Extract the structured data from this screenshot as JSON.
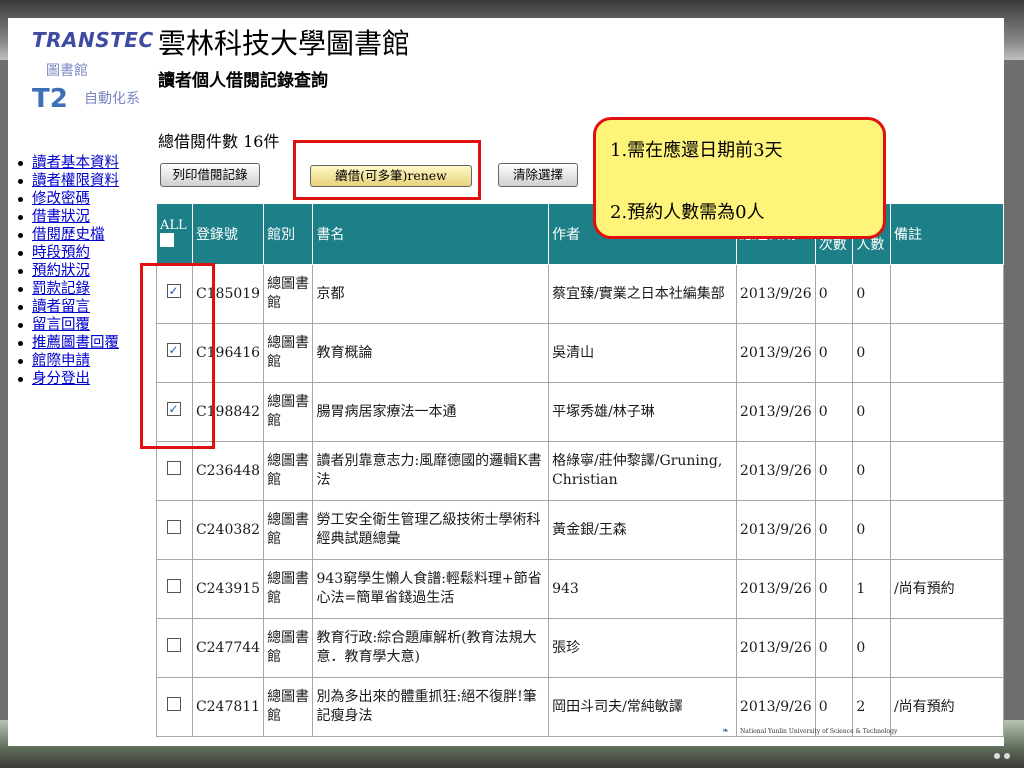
{
  "logo": {
    "brand": "TRANSTEC",
    "brand_sub": "圖書館",
    "t2": "T2",
    "t2_sub": "自動化系"
  },
  "title": "雲林科技大學圖書館",
  "subtitle": "讀者個人借閱記錄查詢",
  "nav": [
    "讀者基本資料",
    "讀者權限資料",
    "修改密碼",
    "借書狀況",
    "借閱歷史檔",
    "時段預約",
    "預約狀況",
    "罰款記錄",
    "讀者留言",
    "留言回覆",
    "推薦圖書回覆",
    "館際申請",
    "身分登出"
  ],
  "total_label": "總借閱件數 16件",
  "buttons": {
    "print": "列印借閱記錄",
    "renew": "續借(可多筆)renew",
    "clear": "清除選擇"
  },
  "callout": {
    "line1": "1.需在應還日期前3天",
    "line2": "2.預約人數需為0人"
  },
  "table": {
    "headers": {
      "all": "ALL",
      "barcode": "登錄號",
      "branch": "館別",
      "title": "書名",
      "author": "作者",
      "due": "應還日期",
      "renewed": "續借次數",
      "reserve": "預約人數",
      "note": "備註"
    },
    "rows": [
      {
        "checked": true,
        "barcode": "C185019",
        "branch": "總圖書館",
        "title": "京都",
        "author": "蔡宜臻/實業之日本社編集部",
        "due": "2013/9/26",
        "renewed": "0",
        "reserve": "0",
        "note": ""
      },
      {
        "checked": true,
        "barcode": "C196416",
        "branch": "總圖書館",
        "title": "教育概論",
        "author": "吳清山",
        "due": "2013/9/26",
        "renewed": "0",
        "reserve": "0",
        "note": ""
      },
      {
        "checked": true,
        "barcode": "C198842",
        "branch": "總圖書館",
        "title": "腸胃病居家療法一本通",
        "author": "平塚秀雄/林子琳",
        "due": "2013/9/26",
        "renewed": "0",
        "reserve": "0",
        "note": ""
      },
      {
        "checked": false,
        "barcode": "C236448",
        "branch": "總圖書館",
        "title": "讀者別靠意志力:風靡德國的邏輯K書法",
        "author": "格綠寧/莊仲黎譯/Gruning, Christian",
        "due": "2013/9/26",
        "renewed": "0",
        "reserve": "0",
        "note": ""
      },
      {
        "checked": false,
        "barcode": "C240382",
        "branch": "總圖書館",
        "title": "勞工安全衛生管理乙級技術士學術科經典試題總彙",
        "author": "黃金銀/王森",
        "due": "2013/9/26",
        "renewed": "0",
        "reserve": "0",
        "note": ""
      },
      {
        "checked": false,
        "barcode": "C243915",
        "branch": "總圖書館",
        "title": "943窮學生懶人食譜:輕鬆料理+節省心法=簡單省錢過生活",
        "author": "943",
        "due": "2013/9/26",
        "renewed": "0",
        "reserve": "1",
        "note": "/尚有預約"
      },
      {
        "checked": false,
        "barcode": "C247744",
        "branch": "總圖書館",
        "title": "教育行政:綜合題庫解析(教育法規大意．教育學大意)",
        "author": "張珍",
        "due": "2013/9/26",
        "renewed": "0",
        "reserve": "0",
        "note": ""
      },
      {
        "checked": false,
        "barcode": "C247811",
        "branch": "總圖書館",
        "title": "別為多出來的體重抓狂:絕不復胖!筆記瘦身法",
        "author": "岡田斗司夫/常純敏譯",
        "due": "2013/9/26",
        "renewed": "0",
        "reserve": "2",
        "note": "/尚有預約"
      }
    ]
  },
  "footer": "National Yunlin University of Science & Technology"
}
